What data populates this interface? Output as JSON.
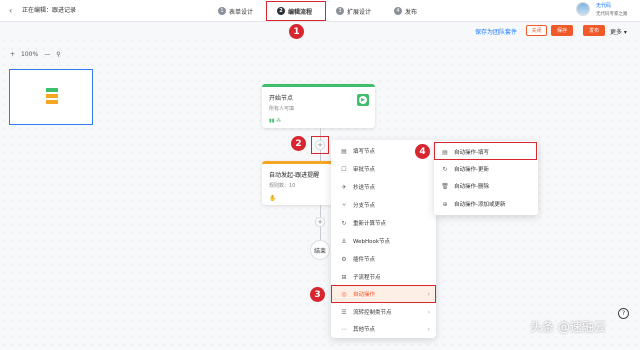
{
  "header": {
    "back_icon": "back-arrow-icon",
    "editing_label": "正在编辑：跟进记录",
    "steps": [
      {
        "num": "1",
        "label": "表单设计"
      },
      {
        "num": "2",
        "label": "编辑流程"
      },
      {
        "num": "3",
        "label": "扩展设计"
      },
      {
        "num": "4",
        "label": "发布"
      }
    ],
    "user": {
      "name": "无代码",
      "title": "无代码专家之路"
    }
  },
  "actions": {
    "save_team_label": "保存为团队套件",
    "close_label": "关闭",
    "save_label": "保存",
    "publish_label": "发布",
    "more_label": "更多"
  },
  "canvas": {
    "zoom_minus": "—",
    "zoom_plus": "+",
    "zoom_level": "100%",
    "nodes": {
      "start": {
        "title": "开始节点",
        "subtitle": "所有人可填"
      },
      "auto": {
        "title": "自动发起-跟进提醒",
        "subtitle": "规则数：10"
      },
      "end_label": "结束"
    }
  },
  "annotations": [
    "1",
    "2",
    "3",
    "4"
  ],
  "menu": {
    "items": [
      {
        "icon": "form-icon",
        "glyph": "▤",
        "label": "填写节点"
      },
      {
        "icon": "approval-icon",
        "glyph": "☐",
        "label": "审批节点"
      },
      {
        "icon": "cc-icon",
        "glyph": "✈",
        "label": "抄送节点"
      },
      {
        "icon": "branch-icon",
        "glyph": "⑂",
        "label": "分支节点"
      },
      {
        "icon": "recalc-icon",
        "glyph": "↻",
        "label": "重新计算节点"
      },
      {
        "icon": "webhook-icon",
        "glyph": "⚓",
        "label": "WebHook节点"
      },
      {
        "icon": "plugin-icon",
        "glyph": "⚙",
        "label": "插件节点"
      },
      {
        "icon": "subflow-icon",
        "glyph": "⊞",
        "label": "子流程节点"
      },
      {
        "icon": "auto-operation-icon",
        "glyph": "◎",
        "label": "自动操作"
      },
      {
        "icon": "flow-control-icon",
        "glyph": "☰",
        "label": "流转控制类节点"
      },
      {
        "icon": "other-icon",
        "glyph": "⋯",
        "label": "其他节点"
      }
    ]
  },
  "submenu": {
    "items": [
      {
        "icon": "fill-icon",
        "glyph": "▤",
        "label": "自动操作-填写"
      },
      {
        "icon": "update-icon",
        "glyph": "↻",
        "label": "自动操作-更新"
      },
      {
        "icon": "delete-icon",
        "glyph": "🗑",
        "label": "自动操作-删除"
      },
      {
        "icon": "add-or-update-icon",
        "glyph": "⊕",
        "label": "自动操作-添加或更新"
      }
    ]
  },
  "watermark": "头条 @速融云",
  "help_glyph": "?",
  "colors": {
    "accent": "#f05a2a",
    "link": "#1677ff",
    "start": "#3fbf6e",
    "auto": "#f5a623",
    "annotation": "#d7262f"
  }
}
